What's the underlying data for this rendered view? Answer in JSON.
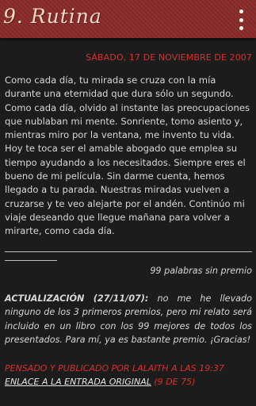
{
  "appbar": {
    "title": "9. Rutina",
    "menu_icon": "overflow-menu-icon",
    "color": "#8a2a2a"
  },
  "post": {
    "date": "SÁBADO, 17 DE NOVIEMBRE DE 2007",
    "body": "Como cada día, tu mirada se cruza con la mía durante una eternidad que dura sólo un segundo. Como cada día, olvido al instante las preocupaciones que nublaban mi mente. Sonriente, tomo asiento y, mientras miro por la ventana, me invento tu vida. Hoy te toca ser el amable abogado que emplea su tiempo ayudando a los necesitados. Siempre eres el bueno de mi película. Sin darme cuenta, hemos llegado a tu parada. Nuestras miradas vuelven a cruzarse y te veo alejarte por el andén. Continúo mi viaje deseando que llegue mañana para volver a mirarte, como cada día.",
    "word_count": "99 palabras sin premio",
    "update_label": "ACTUALIZACIÓN (27/11/07):",
    "update_text": " no me he llevado ninguno de los 3 primeros premios, pero mi relato será incluido en un libro con los 99 mejores de todos los presentados. Para mí, ya es bastante premio. ¡Gracias!",
    "footer_posted": "PENSADO Y PUBLICADO POR LALAITH A LAS 19:37",
    "footer_link": "ENLACE A LA ENTRADA ORIGINAL",
    "footer_count": "(9 DE 75)"
  },
  "colors": {
    "accent_red": "#d83030",
    "background": "#1c1c1c"
  }
}
